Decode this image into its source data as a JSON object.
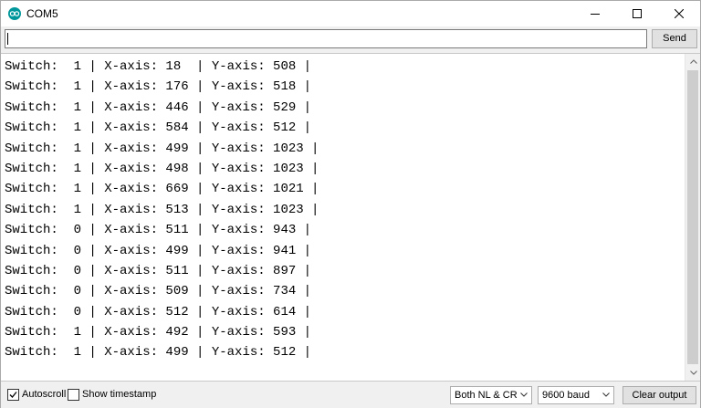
{
  "window": {
    "title": "COM5",
    "app_icon": "arduino-icon",
    "controls": {
      "minimize_icon": "minimize-icon",
      "maximize_icon": "maximize-icon",
      "close_icon": "close-icon"
    }
  },
  "input": {
    "value": "",
    "placeholder": "",
    "send_label": "Send"
  },
  "output": {
    "lines": [
      "Switch:  1 | X-axis: 18  | Y-axis: 508 |",
      "Switch:  1 | X-axis: 176 | Y-axis: 518 |",
      "Switch:  1 | X-axis: 446 | Y-axis: 529 |",
      "Switch:  1 | X-axis: 584 | Y-axis: 512 |",
      "Switch:  1 | X-axis: 499 | Y-axis: 1023 |",
      "Switch:  1 | X-axis: 498 | Y-axis: 1023 |",
      "Switch:  1 | X-axis: 669 | Y-axis: 1021 |",
      "Switch:  1 | X-axis: 513 | Y-axis: 1023 |",
      "Switch:  0 | X-axis: 511 | Y-axis: 943 |",
      "Switch:  0 | X-axis: 499 | Y-axis: 941 |",
      "Switch:  0 | X-axis: 511 | Y-axis: 897 |",
      "Switch:  0 | X-axis: 509 | Y-axis: 734 |",
      "Switch:  0 | X-axis: 512 | Y-axis: 614 |",
      "Switch:  1 | X-axis: 492 | Y-axis: 593 |",
      "Switch:  1 | X-axis: 499 | Y-axis: 512 |"
    ]
  },
  "bottom": {
    "autoscroll": {
      "label": "Autoscroll",
      "checked": true
    },
    "timestamp": {
      "label": "Show timestamp",
      "checked": false
    },
    "line_ending": "Both NL & CR",
    "baud_rate": "9600 baud",
    "clear_label": "Clear output"
  },
  "colors": {
    "accent": "#00979c",
    "window_bg": "#f0f0f0",
    "output_bg": "#ffffff"
  }
}
